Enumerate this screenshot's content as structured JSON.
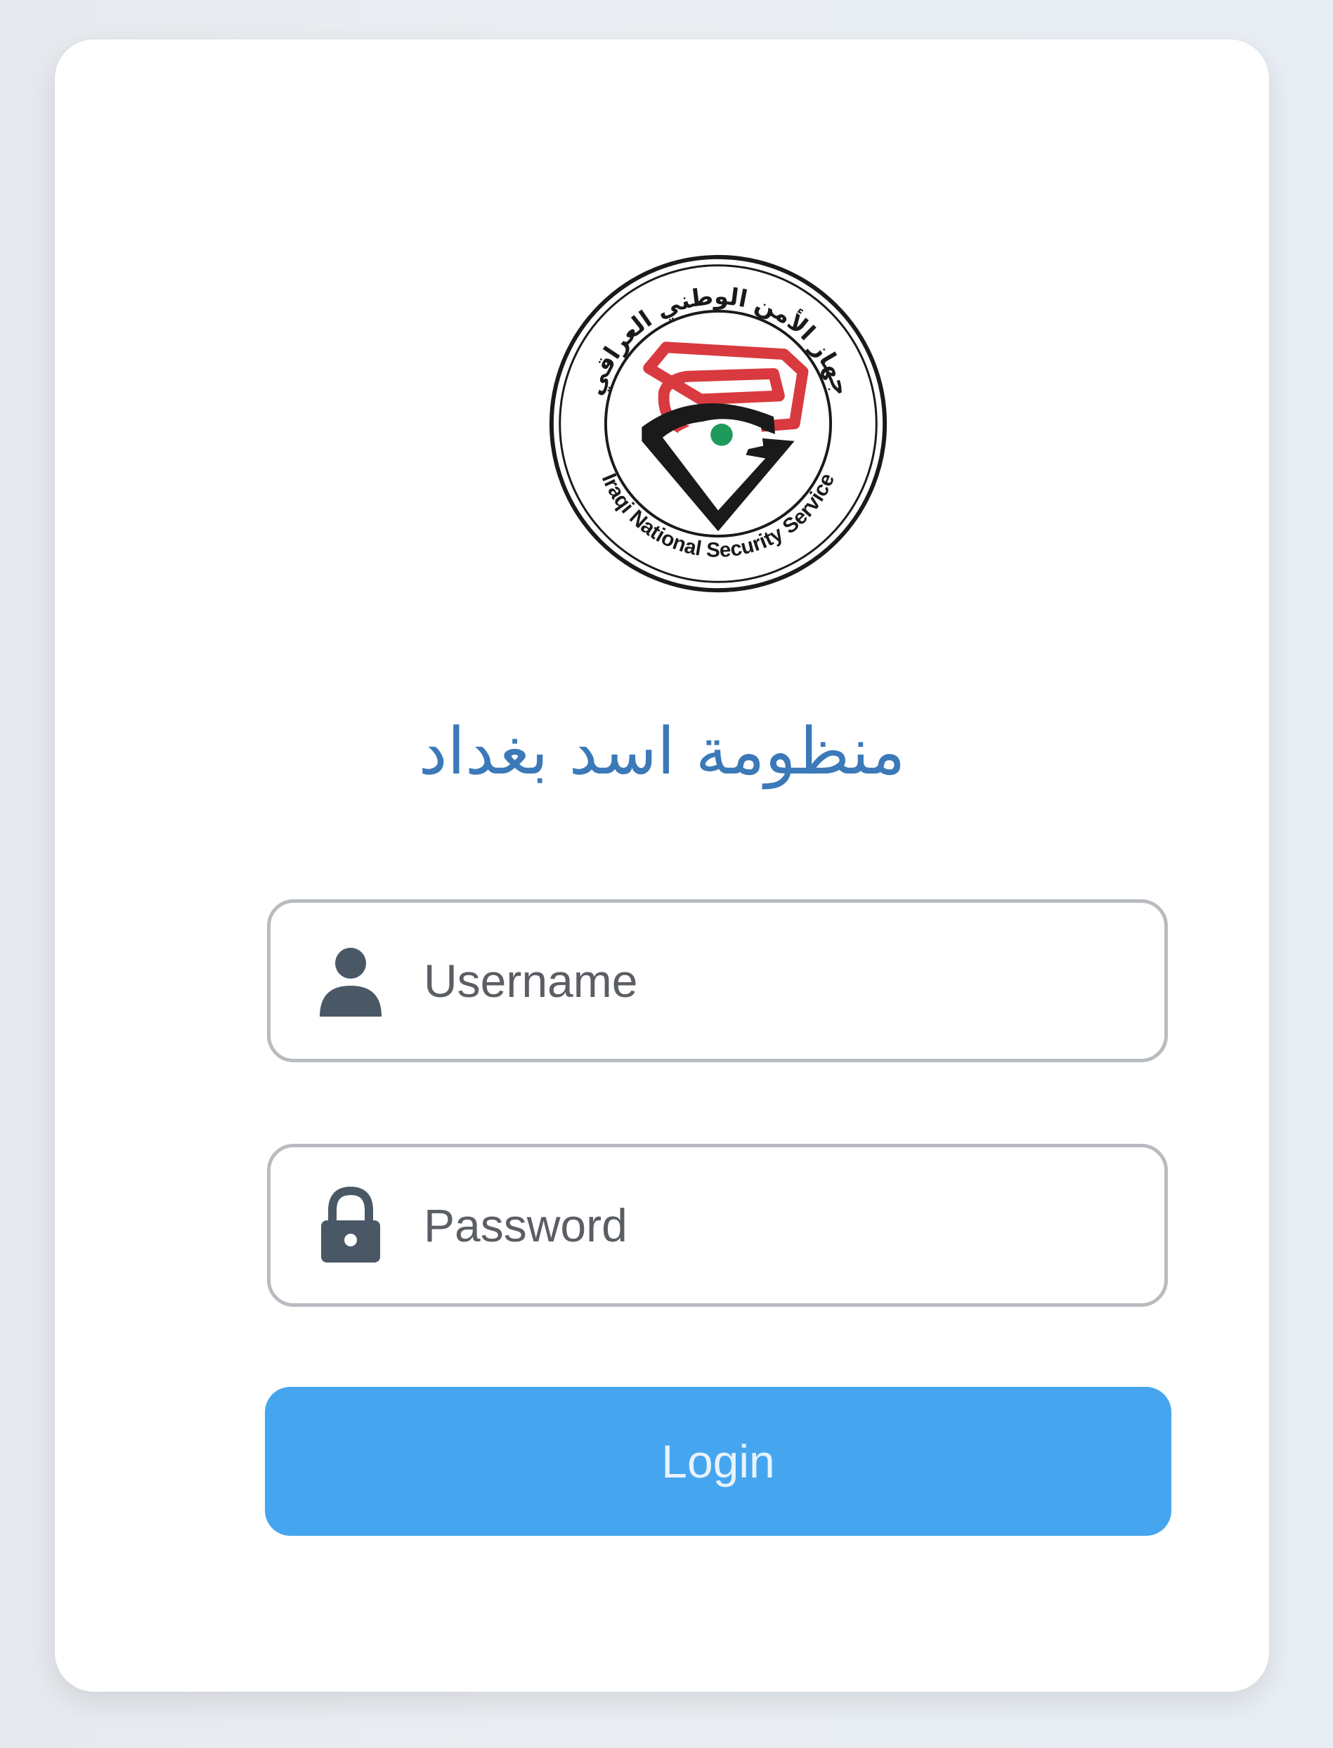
{
  "logo": {
    "arabic_ring_text": "جهاز الأمن الوطني العراقي",
    "english_ring_text": "Iraqi National Security Service"
  },
  "title": "منظومة اسد بغداد",
  "username": {
    "placeholder": "Username",
    "value": "",
    "icon": "user-icon"
  },
  "password": {
    "placeholder": "Password",
    "value": "",
    "icon": "lock-icon"
  },
  "login_button": {
    "label": "Login"
  },
  "colors": {
    "accent": "#45a6ef",
    "title": "#3b79b8",
    "icon": "#4a5866",
    "logo_red": "#d83a3f",
    "logo_green": "#1f9a5a"
  }
}
